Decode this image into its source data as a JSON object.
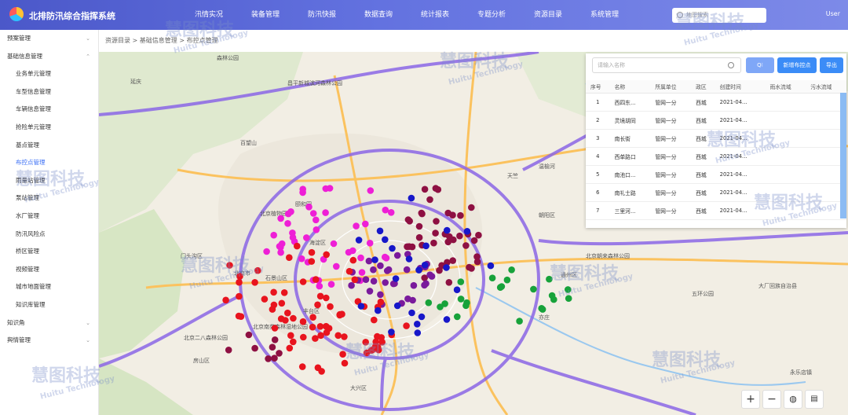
{
  "header": {
    "title": "北排防汛综合指挥系统",
    "search_placeholder": "地图搜索",
    "user": "User",
    "nav": [
      "汛情实况",
      "装备管理",
      "防汛快报",
      "数据查询",
      "统计报表",
      "专题分析",
      "资源目录",
      "系统管理"
    ]
  },
  "sidebar": {
    "items": [
      {
        "label": "预案管理",
        "level": 0,
        "chev": "⌄"
      },
      {
        "label": "基础信息管理",
        "level": 0,
        "chev": "⌃"
      },
      {
        "label": "业务单元管理",
        "level": 1
      },
      {
        "label": "车型信息管理",
        "level": 1
      },
      {
        "label": "车辆信息管理",
        "level": 1
      },
      {
        "label": "抢险单元管理",
        "level": 1
      },
      {
        "label": "基点管理",
        "level": 1
      },
      {
        "label": "布控点管理",
        "level": 1,
        "active": true
      },
      {
        "label": "雨量站管理",
        "level": 1
      },
      {
        "label": "泵站管理",
        "level": 1
      },
      {
        "label": "水厂管理",
        "level": 1
      },
      {
        "label": "防汛风险点",
        "level": 1
      },
      {
        "label": "桥区管理",
        "level": 1
      },
      {
        "label": "视频管理",
        "level": 1
      },
      {
        "label": "城市地面管理",
        "level": 1
      },
      {
        "label": "知识库管理",
        "level": 1
      },
      {
        "label": "知识角",
        "level": 0,
        "chev": "⌄"
      },
      {
        "label": "舆情管理",
        "level": 0,
        "chev": "⌄"
      }
    ]
  },
  "breadcrumb": [
    "资源目录",
    "基础信息管理",
    "布控点管理"
  ],
  "panel": {
    "search_placeholder": "请输入名称",
    "btn_new": "新增布控点",
    "btn_export": "导出",
    "columns": [
      "序号",
      "名称",
      "所属单位",
      "政区",
      "创建时间",
      "雨水流域",
      "污水流域"
    ],
    "rows": [
      [
        "1",
        "西四东...",
        "管网一分",
        "西城",
        "2021-04..."
      ],
      [
        "2",
        "灵境胡同",
        "管网一分",
        "西城",
        "2021-04..."
      ],
      [
        "3",
        "南长街",
        "管网一分",
        "西城",
        "2021-04..."
      ],
      [
        "4",
        "西单路口",
        "管网一分",
        "西城",
        "2021-04..."
      ],
      [
        "5",
        "南池口...",
        "管网一分",
        "西城",
        "2021-04..."
      ],
      [
        "6",
        "南礼士路",
        "管网一分",
        "西城",
        "2021-04..."
      ],
      [
        "7",
        "三里河...",
        "管网一分",
        "西城",
        "2021-04..."
      ]
    ]
  },
  "map": {
    "labels": [
      "昌平新城滨河森林公园",
      "森林公园",
      "百望山",
      "北京植物园",
      "颐和园",
      "海淀区",
      "石景山区",
      "北京市",
      "丰台区",
      "北京南苑森林湿地公园",
      "大兴区",
      "通州区",
      "北京朝来森林公园",
      "温榆河",
      "朝阳区",
      "门头沟区",
      "北京二八森林公园",
      "天竺",
      "延庆",
      "五环公园",
      "大厂回族自治县",
      "永乐店镇",
      "亦庄",
      "房山区"
    ],
    "colors": {
      "magenta": "#ee1fd6",
      "navy": "#1717c9",
      "maroon": "#8e1042",
      "red": "#e8141e",
      "purple": "#7a1a9c",
      "green": "#17a23a",
      "route": "#8b66e6"
    }
  },
  "watermark": {
    "cn": "慧图科技",
    "en": "Huitu Technology"
  }
}
